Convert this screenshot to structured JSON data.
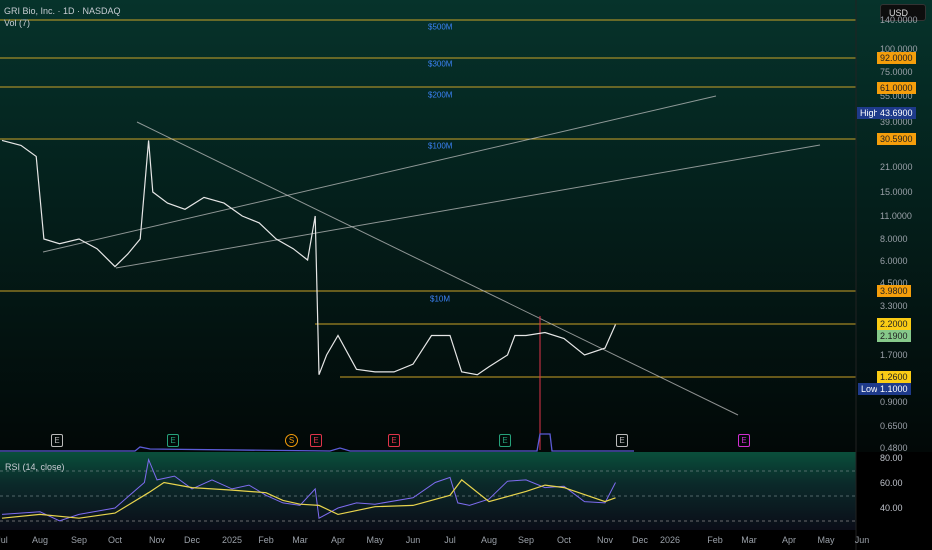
{
  "header": {
    "title": "GRI Bio, Inc. · 1D · NASDAQ",
    "volume_label": "Vol (7)",
    "currency": "USD"
  },
  "rsi": {
    "label": "RSI (14, close)",
    "ticks": [
      "80.00",
      "60.00",
      "40.00"
    ]
  },
  "price_axis": {
    "ticks": [
      "140.0000",
      "100.0000",
      "75.0000",
      "55.0000",
      "39.0000",
      "21.0000",
      "15.0000",
      "11.0000",
      "8.0000",
      "6.0000",
      "4.5000",
      "3.3000",
      "1.7000",
      "0.9000",
      "0.6500",
      "0.4800"
    ]
  },
  "level_tags": [
    {
      "value": "92.0000",
      "color": "#f59e0b"
    },
    {
      "value": "61.0000",
      "color": "#f59e0b"
    },
    {
      "value": "30.5900",
      "color": "#f59e0b"
    },
    {
      "value": "3.9800",
      "color": "#f59e0b"
    },
    {
      "value": "2.2000",
      "color": "#facc15"
    },
    {
      "value": "2.1900",
      "color": "#86c98a"
    },
    {
      "value": "1.2600",
      "color": "#facc15"
    }
  ],
  "high": {
    "label": "High",
    "value": "43.6900"
  },
  "low": {
    "label": "Low",
    "value": "1.1000"
  },
  "volume_labels": [
    "$500M",
    "$300M",
    "$200M",
    "$100M",
    "$10M"
  ],
  "months": [
    "Jul",
    "Aug",
    "Sep",
    "Oct",
    "Nov",
    "Dec",
    "2025",
    "Feb",
    "Mar",
    "Apr",
    "May",
    "Jun",
    "Jul",
    "Aug",
    "Sep",
    "Oct",
    "Nov",
    "Dec",
    "2026",
    "Feb",
    "Mar",
    "Apr",
    "May",
    "Jun"
  ],
  "events": [
    {
      "label": "E",
      "color": "#bbbbbb"
    },
    {
      "label": "E",
      "color": "#26a17b"
    },
    {
      "label": "S",
      "color": "#f59e0b"
    },
    {
      "label": "E",
      "color": "#e0344a"
    },
    {
      "label": "E",
      "color": "#e0344a"
    },
    {
      "label": "E",
      "color": "#26a17b"
    },
    {
      "label": "E",
      "color": "#bbbbbb"
    },
    {
      "label": "E",
      "color": "#d02fd0"
    }
  ],
  "chart_data": {
    "type": "line",
    "title": "GRI Bio, Inc. · 1D · NASDAQ",
    "yscale": "log",
    "ylabel": "USD",
    "x_unit": "months since Jul 2024",
    "price": [
      [
        0,
        30
      ],
      [
        0.5,
        28
      ],
      [
        0.9,
        24
      ],
      [
        1.1,
        8
      ],
      [
        1.5,
        7.5
      ],
      [
        2,
        8
      ],
      [
        2.5,
        7
      ],
      [
        3,
        5.5
      ],
      [
        3.3,
        6.5
      ],
      [
        3.6,
        8
      ],
      [
        3.8,
        30
      ],
      [
        3.9,
        15
      ],
      [
        4.3,
        13
      ],
      [
        4.8,
        12
      ],
      [
        5.3,
        14
      ],
      [
        5.8,
        13
      ],
      [
        6.3,
        11
      ],
      [
        6.8,
        10
      ],
      [
        7.3,
        8
      ],
      [
        7.8,
        7
      ],
      [
        8.2,
        6
      ],
      [
        8.4,
        11
      ],
      [
        8.5,
        1.3
      ],
      [
        8.7,
        1.7
      ],
      [
        9,
        2.0
      ],
      [
        9.5,
        1.4
      ],
      [
        10,
        1.35
      ],
      [
        10.5,
        1.35
      ],
      [
        11,
        1.5
      ],
      [
        11.5,
        2.0
      ],
      [
        12,
        2.0
      ],
      [
        12.3,
        1.35
      ],
      [
        12.7,
        1.3
      ],
      [
        13,
        1.45
      ],
      [
        13.5,
        1.7
      ],
      [
        13.7,
        2.0
      ],
      [
        14,
        2.0
      ],
      [
        14.5,
        2.05
      ],
      [
        15,
        1.95
      ],
      [
        15.5,
        1.7
      ],
      [
        16,
        1.8
      ],
      [
        16.3,
        2.19
      ]
    ],
    "rsi": [
      [
        0,
        35
      ],
      [
        1,
        37
      ],
      [
        1.5,
        30
      ],
      [
        2,
        35
      ],
      [
        3,
        40
      ],
      [
        3.7,
        60
      ],
      [
        3.8,
        78
      ],
      [
        4,
        62
      ],
      [
        4.5,
        65
      ],
      [
        5,
        55
      ],
      [
        5.5,
        62
      ],
      [
        6,
        55
      ],
      [
        6.5,
        58
      ],
      [
        7,
        50
      ],
      [
        7.5,
        44
      ],
      [
        8,
        42
      ],
      [
        8.4,
        55
      ],
      [
        8.5,
        32
      ],
      [
        9,
        40
      ],
      [
        9.5,
        44
      ],
      [
        10,
        43
      ],
      [
        11,
        48
      ],
      [
        11.6,
        60
      ],
      [
        12,
        64
      ],
      [
        12.2,
        44
      ],
      [
        12.5,
        42
      ],
      [
        13,
        47
      ],
      [
        13.5,
        61
      ],
      [
        14,
        62
      ],
      [
        14.5,
        56
      ],
      [
        15,
        57
      ],
      [
        15.5,
        45
      ],
      [
        16,
        44
      ],
      [
        16.3,
        60
      ]
    ],
    "rsi_ma": [
      [
        0,
        32
      ],
      [
        1,
        35
      ],
      [
        2,
        32
      ],
      [
        3,
        36
      ],
      [
        3.8,
        52
      ],
      [
        4.2,
        60
      ],
      [
        5,
        56
      ],
      [
        6,
        54
      ],
      [
        7,
        52
      ],
      [
        7.5,
        46
      ],
      [
        8,
        43
      ],
      [
        8.5,
        42
      ],
      [
        9,
        35
      ],
      [
        10,
        41
      ],
      [
        11,
        42
      ],
      [
        12,
        50
      ],
      [
        12.3,
        62
      ],
      [
        13,
        45
      ],
      [
        14,
        53
      ],
      [
        14.5,
        58
      ],
      [
        15,
        56
      ],
      [
        16,
        45
      ],
      [
        16.3,
        48
      ]
    ],
    "levels": [
      140,
      92,
      61,
      30.59,
      3.98,
      2.2,
      1.26
    ],
    "rsi_range": [
      20,
      85
    ]
  }
}
